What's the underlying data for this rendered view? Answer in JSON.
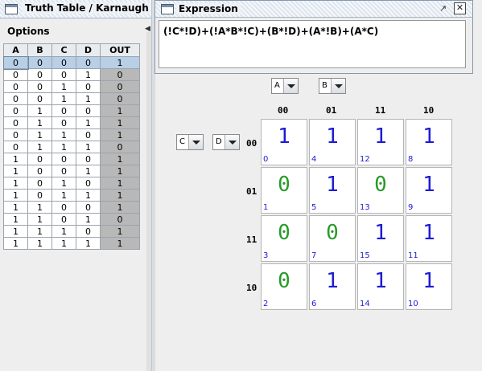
{
  "truth_window": {
    "title": "Truth Table / Karnaugh Map"
  },
  "options_label": "Options",
  "table": {
    "headers": [
      "A",
      "B",
      "C",
      "D",
      "OUT"
    ],
    "rows": [
      [
        "0",
        "0",
        "0",
        "0",
        "1"
      ],
      [
        "0",
        "0",
        "0",
        "1",
        "0"
      ],
      [
        "0",
        "0",
        "1",
        "0",
        "0"
      ],
      [
        "0",
        "0",
        "1",
        "1",
        "0"
      ],
      [
        "0",
        "1",
        "0",
        "0",
        "1"
      ],
      [
        "0",
        "1",
        "0",
        "1",
        "1"
      ],
      [
        "0",
        "1",
        "1",
        "0",
        "1"
      ],
      [
        "0",
        "1",
        "1",
        "1",
        "0"
      ],
      [
        "1",
        "0",
        "0",
        "0",
        "1"
      ],
      [
        "1",
        "0",
        "0",
        "1",
        "1"
      ],
      [
        "1",
        "0",
        "1",
        "0",
        "1"
      ],
      [
        "1",
        "0",
        "1",
        "1",
        "1"
      ],
      [
        "1",
        "1",
        "0",
        "0",
        "1"
      ],
      [
        "1",
        "1",
        "0",
        "1",
        "0"
      ],
      [
        "1",
        "1",
        "1",
        "0",
        "1"
      ],
      [
        "1",
        "1",
        "1",
        "1",
        "1"
      ]
    ]
  },
  "expression_window": {
    "title": "Expression",
    "text": "(!C*!D)+(!A*B*!C)+(B*!D)+(A*!B)+(A*C)",
    "float_icon": "↗",
    "close_icon": "✕"
  },
  "kmap": {
    "col_selectors": [
      "A",
      "B"
    ],
    "row_selectors": [
      "C",
      "D"
    ],
    "col_headers": [
      "00",
      "01",
      "11",
      "10"
    ],
    "row_headers": [
      "00",
      "01",
      "11",
      "10"
    ],
    "cells": [
      [
        {
          "v": "1",
          "i": "0"
        },
        {
          "v": "1",
          "i": "4"
        },
        {
          "v": "1",
          "i": "12"
        },
        {
          "v": "1",
          "i": "8"
        }
      ],
      [
        {
          "v": "0",
          "i": "1"
        },
        {
          "v": "1",
          "i": "5"
        },
        {
          "v": "0",
          "i": "13"
        },
        {
          "v": "1",
          "i": "9"
        }
      ],
      [
        {
          "v": "0",
          "i": "3"
        },
        {
          "v": "0",
          "i": "7"
        },
        {
          "v": "1",
          "i": "15"
        },
        {
          "v": "1",
          "i": "11"
        }
      ],
      [
        {
          "v": "0",
          "i": "2"
        },
        {
          "v": "1",
          "i": "6"
        },
        {
          "v": "1",
          "i": "14"
        },
        {
          "v": "1",
          "i": "10"
        }
      ]
    ]
  }
}
